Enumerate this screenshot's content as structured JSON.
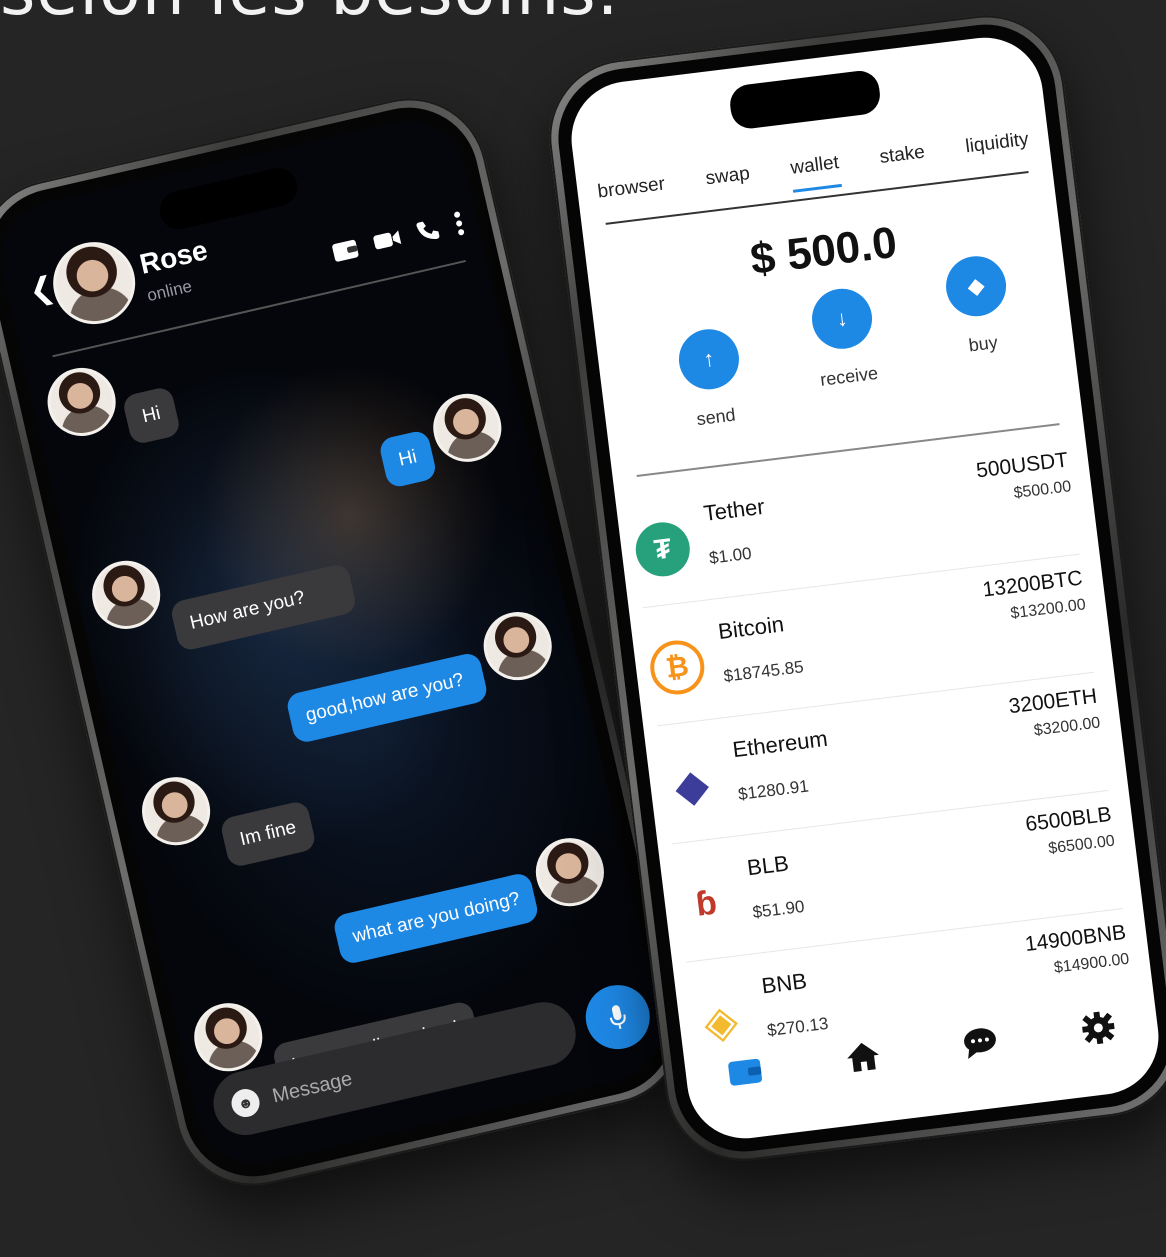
{
  "headline": "selon les besoins.",
  "chat": {
    "contact_name": "Rose",
    "contact_status": "online",
    "messages": [
      {
        "text": "Hi",
        "dir": "in"
      },
      {
        "text": "Hi",
        "dir": "out"
      },
      {
        "text": "How are you?",
        "dir": "in"
      },
      {
        "text": "good,how are you?",
        "dir": "out"
      },
      {
        "text": "Im fine",
        "dir": "in"
      },
      {
        "text": "what are you doing?",
        "dir": "out"
      },
      {
        "text": "I was reading a book",
        "dir": "in"
      }
    ],
    "composer_placeholder": "Message",
    "icons": [
      "back-icon",
      "wallet-icon",
      "video-icon",
      "phone-icon",
      "more-icon",
      "emoji-icon",
      "mic-icon"
    ]
  },
  "wallet": {
    "tabs": [
      "browser",
      "swap",
      "wallet",
      "stake",
      "liquidity"
    ],
    "active_tab": "wallet",
    "balance": "$ 500.0",
    "actions": [
      "send",
      "receive",
      "buy"
    ],
    "coins": [
      {
        "name": "Tether",
        "price": "$1.00",
        "amount": "500USDT",
        "value": "$500.00",
        "color": "#26a17b",
        "symbol": "₮"
      },
      {
        "name": "Bitcoin",
        "price": "$18745.85",
        "amount": "13200BTC",
        "value": "$13200.00",
        "color": "#f7931a",
        "symbol": "₿"
      },
      {
        "name": "Ethereum",
        "price": "$1280.91",
        "amount": "3200ETH",
        "value": "$3200.00",
        "color": "#627eea",
        "symbol": "◆"
      },
      {
        "name": "BLB",
        "price": "$51.90",
        "amount": "6500BLB",
        "value": "$6500.00",
        "color": "#ffffff",
        "symbol": "ɓ"
      },
      {
        "name": "BNB",
        "price": "$270.13",
        "amount": "14900BNB",
        "value": "$14900.00",
        "color": "#f3ba2f",
        "symbol": "◈"
      }
    ],
    "nav": [
      "wallet-icon",
      "home-icon",
      "chat-icon",
      "settings-icon"
    ],
    "accent": "#1e88e5"
  }
}
